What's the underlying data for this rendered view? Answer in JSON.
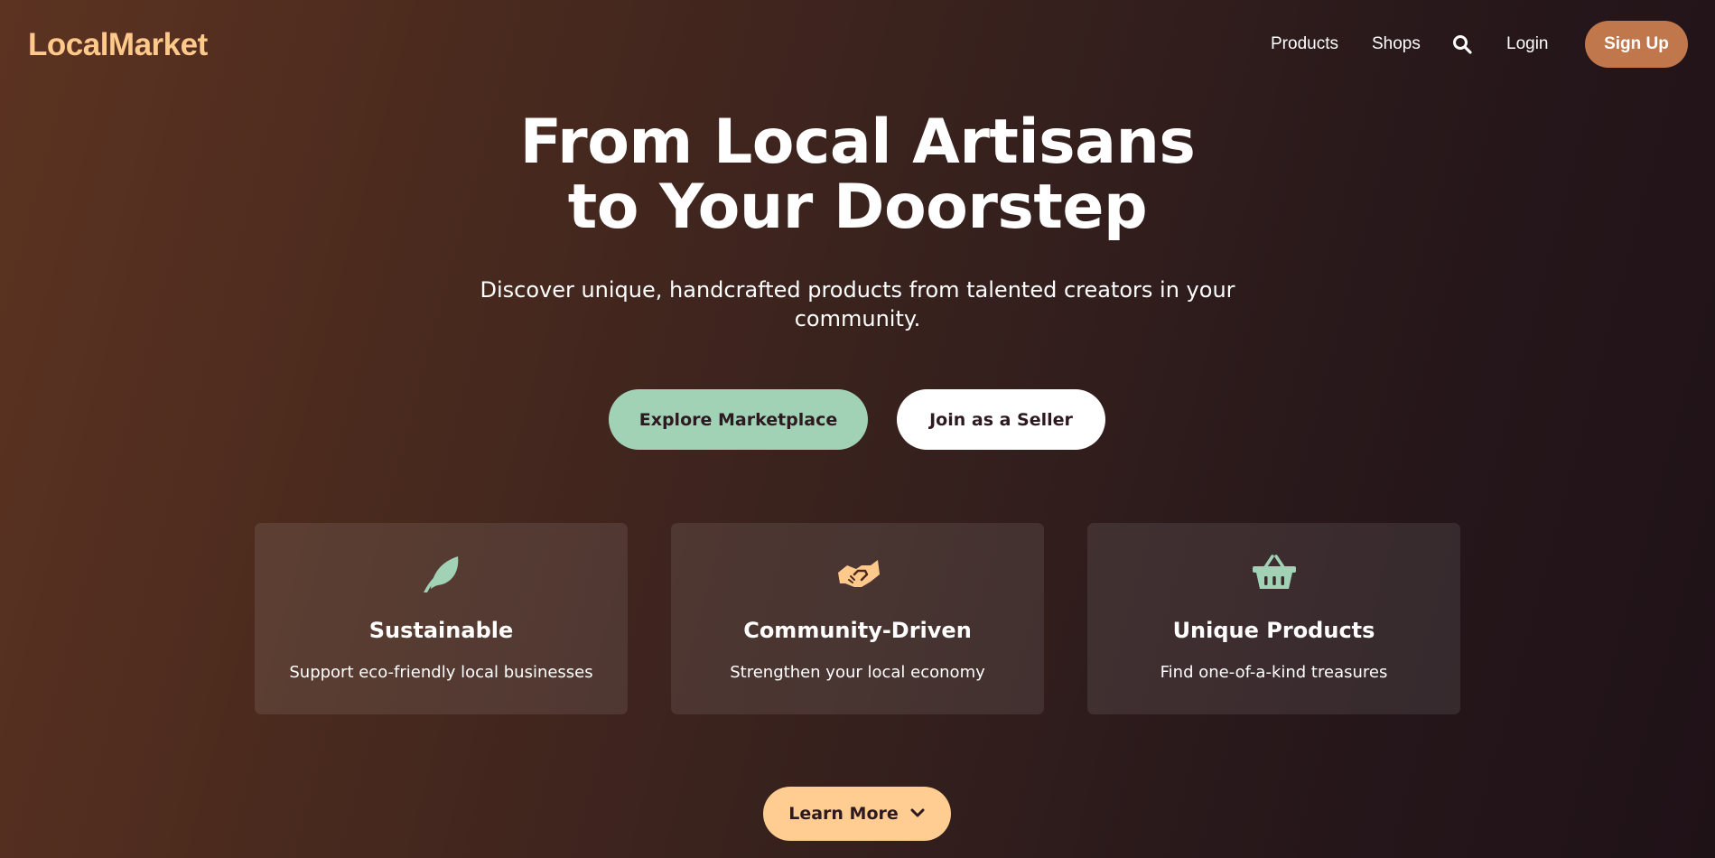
{
  "nav": {
    "logo": "LocalMarket",
    "links": {
      "products": "Products",
      "shops": "Shops",
      "login": "Login"
    },
    "signup_label": "Sign Up",
    "search_icon": "search-icon"
  },
  "hero": {
    "title_line1": "From Local Artisans",
    "title_line2": "to Your Doorstep",
    "subtitle": "Discover unique, handcrafted products from talented creators in your community.",
    "explore_label": "Explore Marketplace",
    "seller_label": "Join as a Seller"
  },
  "features": [
    {
      "icon": "leaf-icon",
      "title": "Sustainable",
      "text": "Support eco-friendly local businesses",
      "icon_color": "#a2d2b6"
    },
    {
      "icon": "handshake-icon",
      "title": "Community-Driven",
      "text": "Strengthen your local economy",
      "icon_color": "#ffc98c"
    },
    {
      "icon": "basket-icon",
      "title": "Unique Products",
      "text": "Find one-of-a-kind treasures",
      "icon_color": "#a2d2b6"
    }
  ],
  "learn_more_label": "Learn More",
  "colors": {
    "accent": "#ffc98c",
    "signup": "#c0774c",
    "mint": "#a2d2b6",
    "learn": "#ffcc91"
  }
}
